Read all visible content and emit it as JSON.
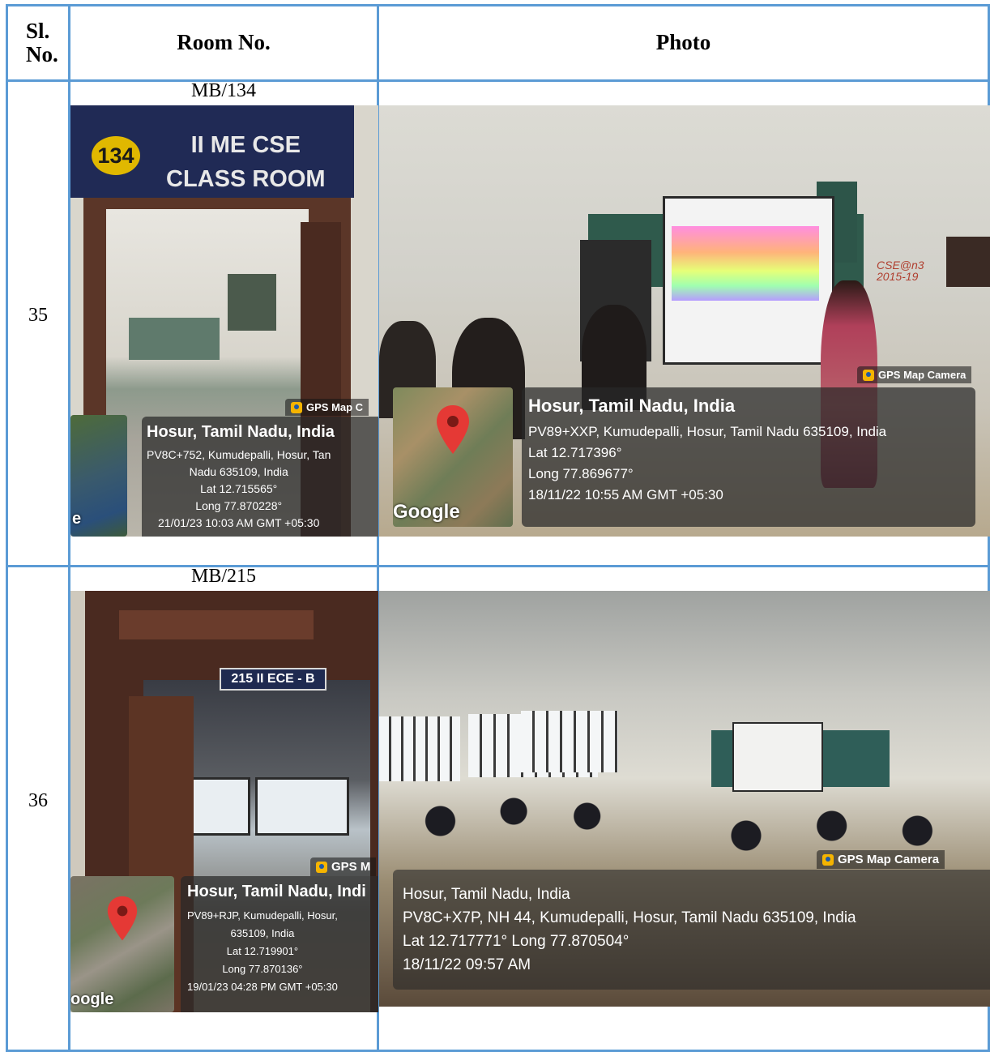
{
  "headers": {
    "sl": "Sl.",
    "sl2": "No.",
    "room": "Room No.",
    "photo": "Photo"
  },
  "rows": [
    {
      "sl": "35",
      "room": "MB/134",
      "room_photo": {
        "sign_number": "134",
        "sign_line1": "II ME CSE",
        "sign_line2": "CLASS ROOM",
        "gps_tag": "GPS Map C",
        "city": "Hosur, Tamil Nadu, India",
        "addr1": "PV8C+752, Kumudepalli, Hosur, Tan",
        "addr2": "Nadu 635109, India",
        "lat": "Lat 12.715565°",
        "long": "Long 77.870228°",
        "time": "21/01/23 10:03 AM GMT +05:30",
        "google": "e"
      },
      "photo": {
        "gps_tag": "GPS Map Camera",
        "city": "Hosur, Tamil Nadu, India",
        "addr": "PV89+XXP, Kumudepalli, Hosur, Tamil Nadu 635109, India",
        "lat": "Lat 12.717396°",
        "long": "Long 77.869677°",
        "time": "18/11/22 10:55 AM GMT +05:30",
        "google": "Google",
        "board_note1": "CSE@n3",
        "board_note2": "2015-19"
      }
    },
    {
      "sl": "36",
      "room": "MB/215",
      "room_photo": {
        "sign": "215  II ECE - B",
        "gps_tag": "GPS M",
        "city": "Hosur, Tamil Nadu, Indi",
        "addr1": "PV89+RJP, Kumudepalli, Hosur,",
        "addr2": "635109, India",
        "lat": "Lat 12.719901°",
        "long": "Long 77.870136°",
        "time": "19/01/23 04:28 PM GMT +05:30",
        "google": "oogle"
      },
      "photo": {
        "gps_tag": "GPS Map Camera",
        "city": "Hosur, Tamil Nadu, India",
        "addr": "PV8C+X7P, NH 44, Kumudepalli, Hosur, Tamil Nadu 635109, India",
        "latlong": "Lat 12.717771° Long 77.870504°",
        "time": "18/11/22 09:57 AM"
      }
    }
  ]
}
